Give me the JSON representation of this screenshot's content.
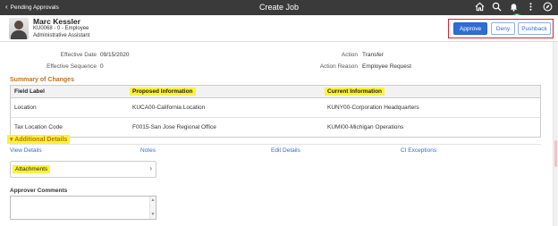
{
  "topbar": {
    "back_label": "Pending Approvals",
    "title": "Create Job",
    "notification_count": "0"
  },
  "employee": {
    "name": "Marc Kessler",
    "id_line": "KU0068 - 0 - Employee",
    "job_title": "Administrative Assistant"
  },
  "actions": {
    "approve_label": "Approve",
    "deny_label": "Deny",
    "pushback_label": "Pushback"
  },
  "details": {
    "effective_date_label": "Effective Date",
    "effective_date_value": "09/15/2020",
    "effective_sequence_label": "Effective Sequence",
    "effective_sequence_value": "0",
    "action_label": "Action",
    "action_value": "Transfer",
    "action_reason_label": "Action Reason",
    "action_reason_value": "Employee Request"
  },
  "summary": {
    "title": "Summary of Changes",
    "headers": [
      "Field Label",
      "Proposed Information",
      "Current Information"
    ],
    "rows": [
      [
        "Location",
        "KUCA00-California Location",
        "KUNY00-Corporation Headquarters"
      ],
      [
        "Tax Location Code",
        "F0015-San Jose Regional Office",
        "KUMI00-Michigan Operations"
      ]
    ]
  },
  "additional": {
    "title": "Additional Details",
    "links": [
      "View Details",
      "Notes",
      "Edit Details",
      "CI Exceptions"
    ],
    "attachments_label": "Attachments",
    "approver_comments_label": "Approver Comments"
  },
  "colors": {
    "topbar": "#3a3a3a",
    "accent_blue": "#2f6dd5",
    "section_orange": "#c0721b",
    "highlight_yellow": "#fbf23a",
    "annotation_red": "#d9232e"
  },
  "icons": [
    "chevron-left-icon",
    "home-icon",
    "search-icon",
    "bell-icon",
    "menu-icon",
    "compass-icon",
    "chevron-right-icon"
  ]
}
